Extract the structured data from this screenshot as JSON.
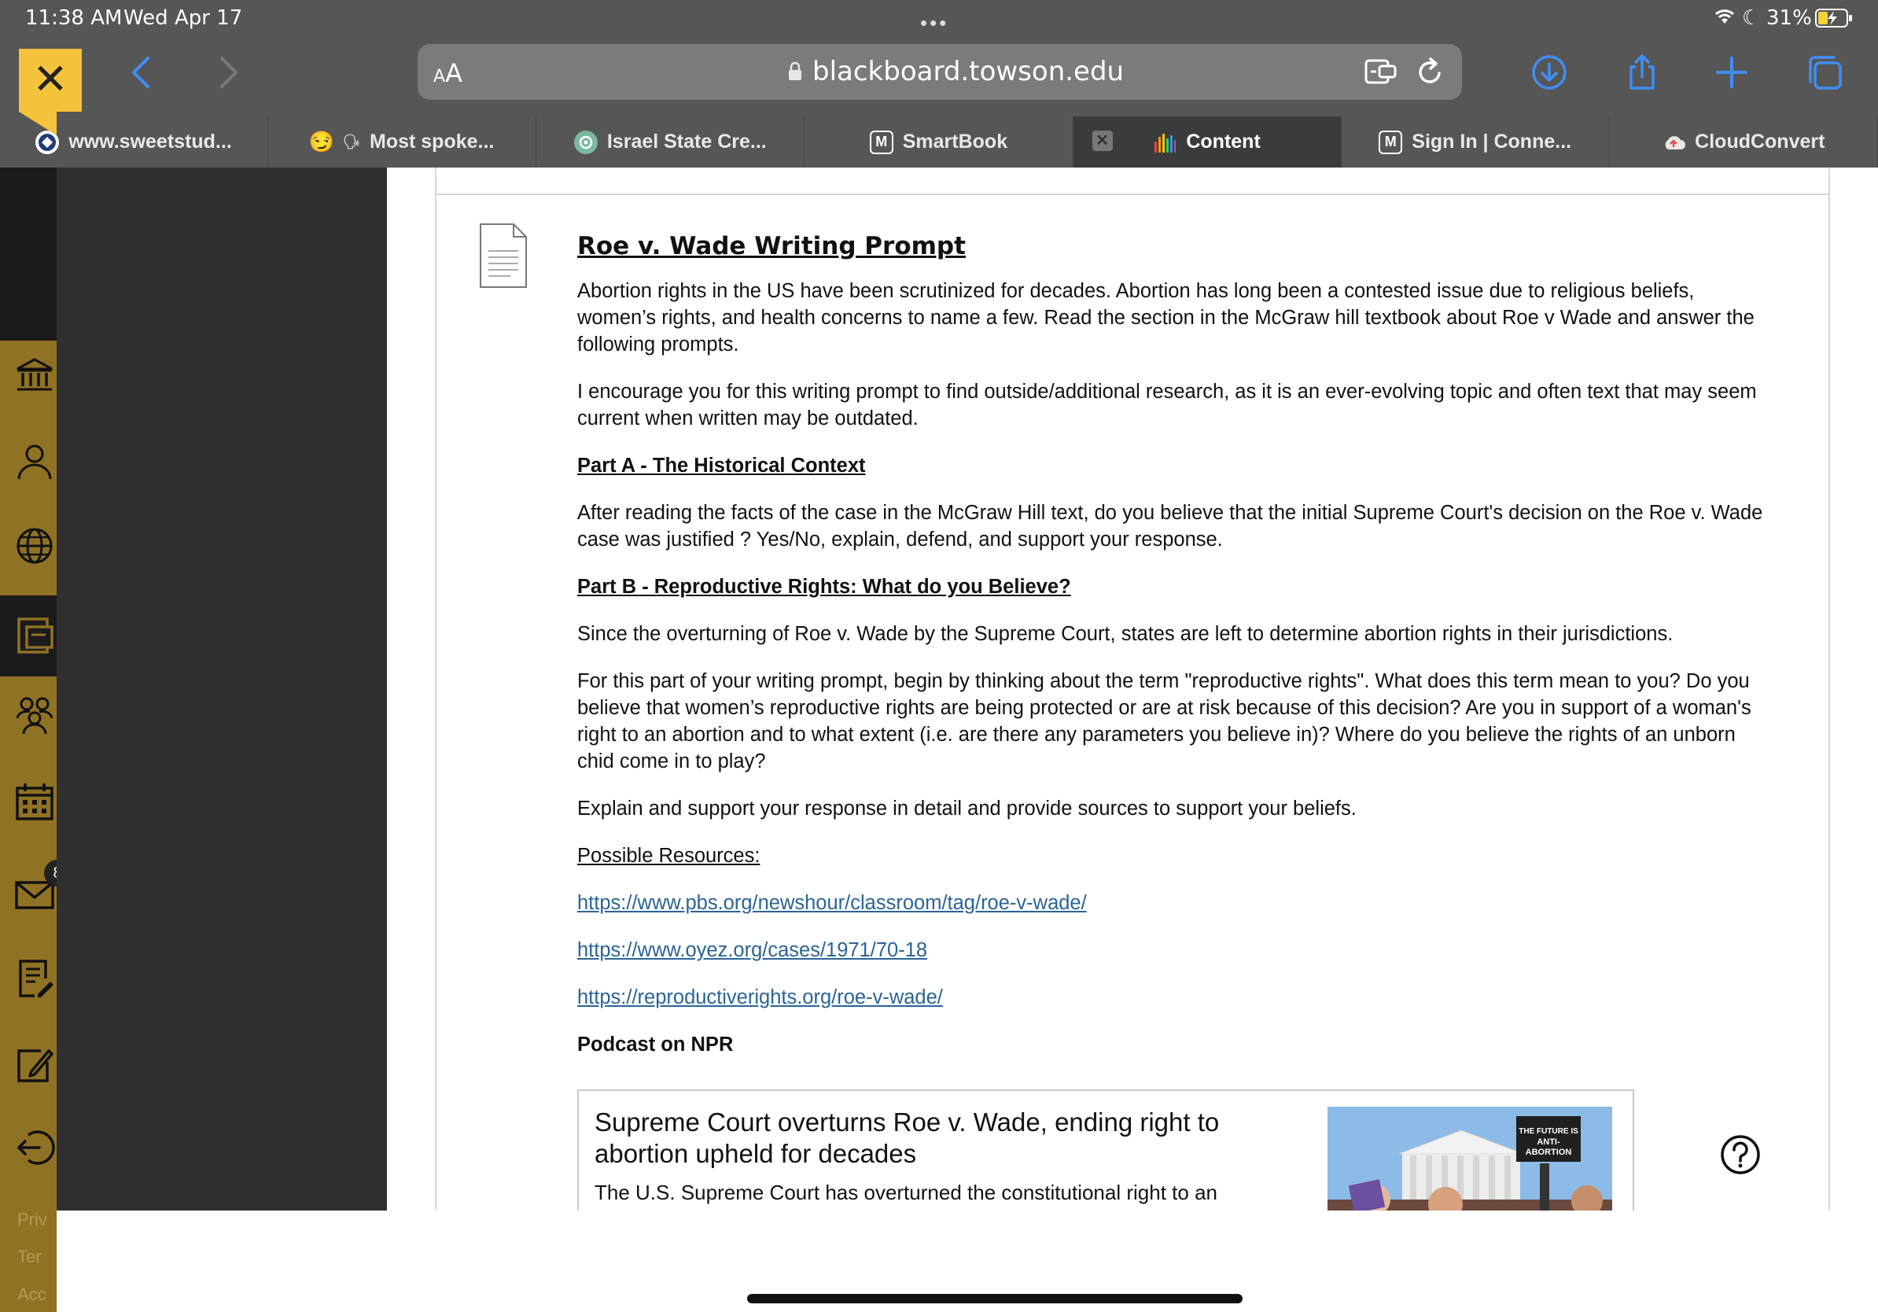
{
  "status_bar": {
    "time": "11:38 AM",
    "date": "Wed Apr 17",
    "battery": "31%"
  },
  "toolbar": {
    "text_size_label": "AA",
    "url": "blackboard.towson.edu"
  },
  "tabs": [
    {
      "label": "www.sweetstud...",
      "icon": "sweetstudy-icon",
      "active": false
    },
    {
      "label": "Most spoke...",
      "icon": "emoji-icon",
      "active": false
    },
    {
      "label": "Israel State Cre...",
      "icon": "chatgpt-icon",
      "active": false
    },
    {
      "label": "SmartBook",
      "icon": "mcgraw-m-icon",
      "active": false
    },
    {
      "label": "Content",
      "icon": "blackboard-bars-icon",
      "active": true
    },
    {
      "label": "Sign In | Conne...",
      "icon": "mcgraw-m-icon",
      "active": false
    },
    {
      "label": "CloudConvert",
      "icon": "cloud-icon",
      "active": false
    }
  ],
  "rail": {
    "mail_badge": "8",
    "footer": [
      "Priv",
      "Ter",
      "Acc"
    ]
  },
  "document": {
    "title": "Roe v. Wade Writing Prompt",
    "intro": "Abortion rights in the US have been scrutinized for decades. Abortion has long been a contested issue due to religious beliefs, women’s rights, and health concerns to name a few. Read the section in the McGraw hill textbook about Roe v Wade and answer the following prompts.",
    "encourage": "I encourage you for this writing prompt to find outside/additional research, as it is an ever-evolving topic and often text that may seem current when written may be outdated.",
    "part_a_heading": "Part A - The Historical Context",
    "part_a_text": "After reading the facts of the case in the McGraw Hill text, do you believe that the initial Supreme Court's decision on the Roe v. Wade case was justified ? Yes/No, explain, defend, and support your response.",
    "part_b_heading": "Part B - Reproductive Rights: What do you Believe?",
    "part_b_text1": "Since the overturning of Roe v. Wade by the Supreme Court, states are left to determine abortion rights in their jurisdictions.",
    "part_b_text2": "For this part of your writing prompt, begin by thinking about the term \"reproductive rights\".  What does this term mean to you?  Do you believe that women’s reproductive rights are being protected or are at risk because of this decision?  Are you in support of a woman's right to an abortion and to what extent (i.e. are there any parameters you believe in)? Where do you believe the rights of an unborn chid come in to play?",
    "part_b_text3": "Explain and support your response in detail and provide sources to support your beliefs.",
    "resources_heading": "Possible Resources:",
    "links": [
      "https://www.pbs.org/newshour/classroom/tag/roe-v-wade/",
      "https://www.oyez.org/cases/1971/70-18",
      "https://reproductiverights.org/roe-v-wade/"
    ],
    "podcast_heading": "Podcast on NPR"
  },
  "npr_card": {
    "title": "Supreme Court overturns Roe v. Wade, ending right to abortion upheld for decades",
    "description": "The U.S. Supreme Court has overturned the constitutional right to an",
    "image_sign_text": "THE FUTURE IS ANTI-ABORTION"
  },
  "colors": {
    "chrome_bg": "#565656",
    "rail_gold": "#907224",
    "close_button": "#f5c33b",
    "dark_panel": "#2f2f2f",
    "link": "#2a6496"
  }
}
